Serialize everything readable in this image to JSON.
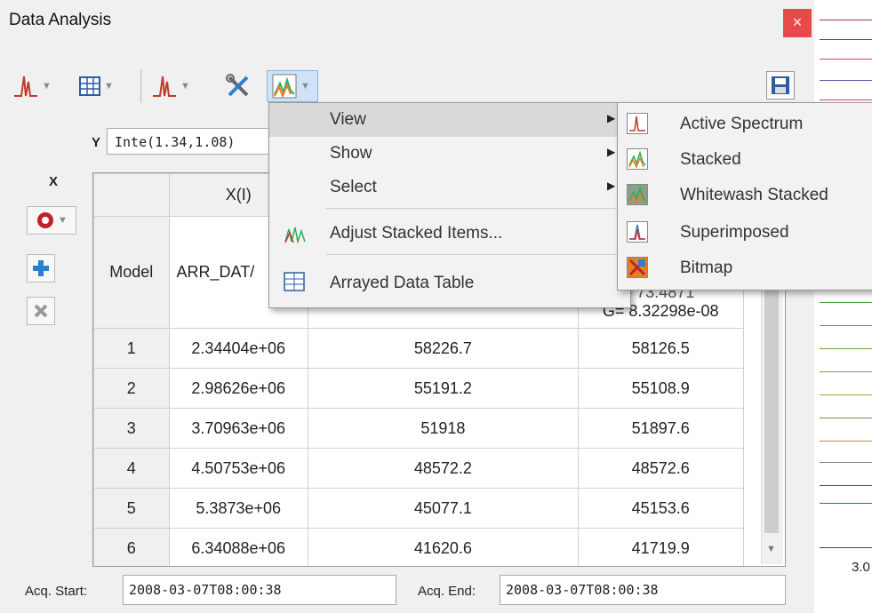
{
  "window": {
    "title": "Data Analysis",
    "close_glyph": "×"
  },
  "y_axis": {
    "label": "Y",
    "expression": "Inte(1.34,1.08)"
  },
  "x_axis": {
    "label": "X"
  },
  "table": {
    "header_col2": "X(I)",
    "model_label": "Model",
    "model_value": "ARR_DAT/",
    "partial_text": "- 73.4871",
    "g_value": "G= 8.32298e-08",
    "rows": [
      {
        "n": "1",
        "x": "2.34404e+06",
        "a": "58226.7",
        "b": "58126.5"
      },
      {
        "n": "2",
        "x": "2.98626e+06",
        "a": "55191.2",
        "b": "55108.9"
      },
      {
        "n": "3",
        "x": "3.70963e+06",
        "a": "51918",
        "b": "51897.6"
      },
      {
        "n": "4",
        "x": "4.50753e+06",
        "a": "48572.2",
        "b": "48572.6"
      },
      {
        "n": "5",
        "x": "5.3873e+06",
        "a": "45077.1",
        "b": "45153.6"
      },
      {
        "n": "6",
        "x": "6.34088e+06",
        "a": "41620.6",
        "b": "41719.9"
      }
    ]
  },
  "acq": {
    "start_label": "Acq. Start:",
    "start_value": "2008-03-07T08:00:38",
    "end_label": "Acq. End:",
    "end_value": "2008-03-07T08:00:38"
  },
  "strip": {
    "axis_label": "3.0"
  },
  "context_menu": {
    "items": [
      {
        "label": "View",
        "submenu": true
      },
      {
        "label": "Show",
        "submenu": true
      },
      {
        "label": "Select",
        "submenu": true
      },
      {
        "label": "Adjust Stacked Items...",
        "submenu": false
      },
      {
        "label": "Arrayed Data Table",
        "submenu": false
      }
    ]
  },
  "view_submenu": {
    "items": [
      {
        "label": "Active Spectrum",
        "icon": "active-spectrum-icon"
      },
      {
        "label": "Stacked",
        "icon": "stacked-icon"
      },
      {
        "label": "Whitewash Stacked",
        "icon": "whitewash-stacked-icon"
      },
      {
        "label": "Superimposed",
        "icon": "superimposed-icon"
      },
      {
        "label": "Bitmap",
        "icon": "bitmap-icon"
      }
    ]
  },
  "colors": {
    "close": "#e74a4a",
    "accent": "#2b7fd0",
    "menu_highlight": "#d9d9d9"
  }
}
